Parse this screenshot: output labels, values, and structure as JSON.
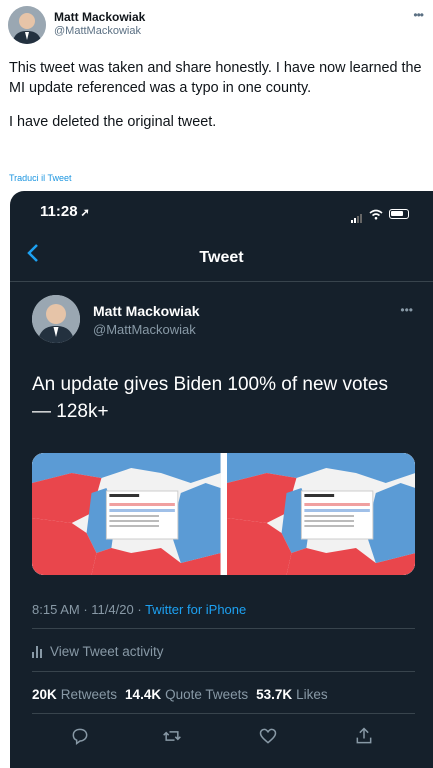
{
  "outer_tweet": {
    "author_name": "Matt Mackowiak",
    "author_handle": "@MattMackowiak",
    "paragraph_1": "This tweet was taken and share honestly. I have now learned the MI update referenced was a typo in one county.",
    "paragraph_2": "I have deleted the original tweet.",
    "translate_label": "Traduci il Tweet"
  },
  "phone": {
    "status_time": "11:28",
    "nav_title": "Tweet",
    "back_icon": "chevron-left-icon"
  },
  "inner_tweet": {
    "author_name": "Matt Mackowiak",
    "author_handle": "@MattMackowiak",
    "text": "An update gives Biden 100% of new votes — 128k+",
    "time": "8:15 AM",
    "date": "11/4/20",
    "sep": "·",
    "source": "Twitter for iPhone",
    "activity_label": "View Tweet activity"
  },
  "stats": {
    "retweets_count": "20K",
    "retweets_label": "Retweets",
    "quotes_count": "14.4K",
    "quotes_label": "Quote Tweets",
    "likes_count": "53.7K",
    "likes_label": "Likes"
  },
  "colors": {
    "phone_bg": "#15202b",
    "accent": "#1da1f2",
    "muted": "#8899a6",
    "map_red": "#e9464c",
    "map_blue": "#5b9bd5"
  }
}
